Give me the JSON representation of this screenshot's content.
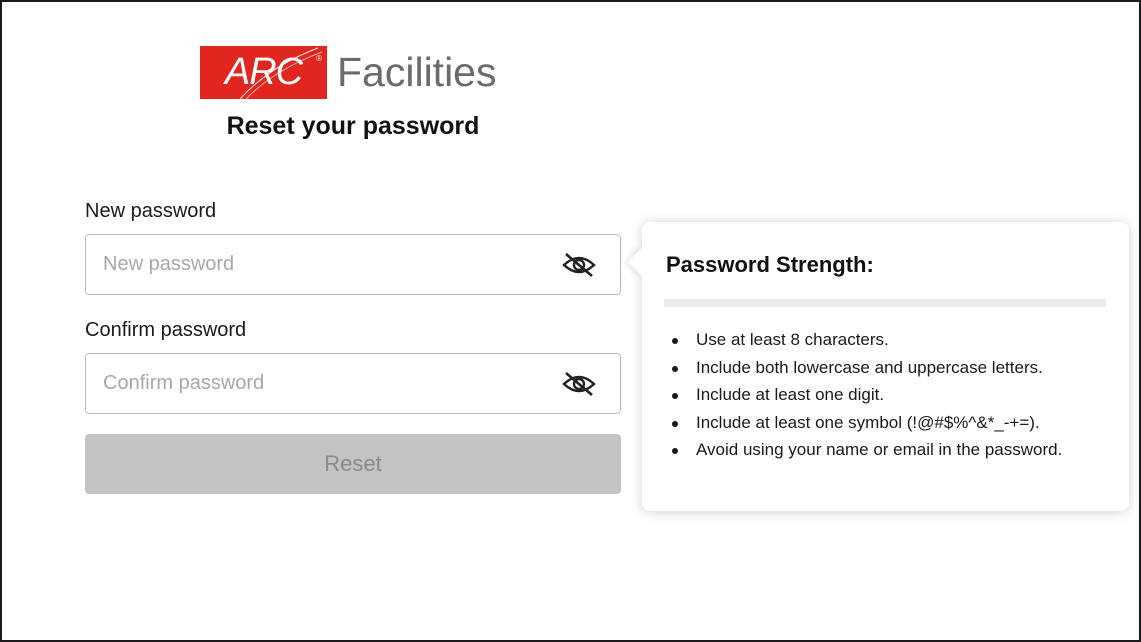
{
  "brand": {
    "mark": "ARC",
    "registered": "®",
    "wordmark": "Facilities",
    "mark_color": "#e0261f"
  },
  "title": "Reset your password",
  "form": {
    "new_password": {
      "label": "New password",
      "placeholder": "New password",
      "value": "",
      "toggle_icon": "eye-slash-icon"
    },
    "confirm_password": {
      "label": "Confirm password",
      "placeholder": "Confirm password",
      "value": "",
      "toggle_icon": "eye-slash-icon"
    },
    "reset_label": "Reset",
    "reset_enabled": false
  },
  "strength": {
    "title": "Password Strength:",
    "level": 0,
    "rules": [
      "Use at least 8 characters.",
      "Include both lowercase and uppercase letters.",
      "Include at least one digit.",
      "Include at least one symbol (!@#$%^&*_-+=).",
      "Avoid using your name or email in the password."
    ]
  }
}
